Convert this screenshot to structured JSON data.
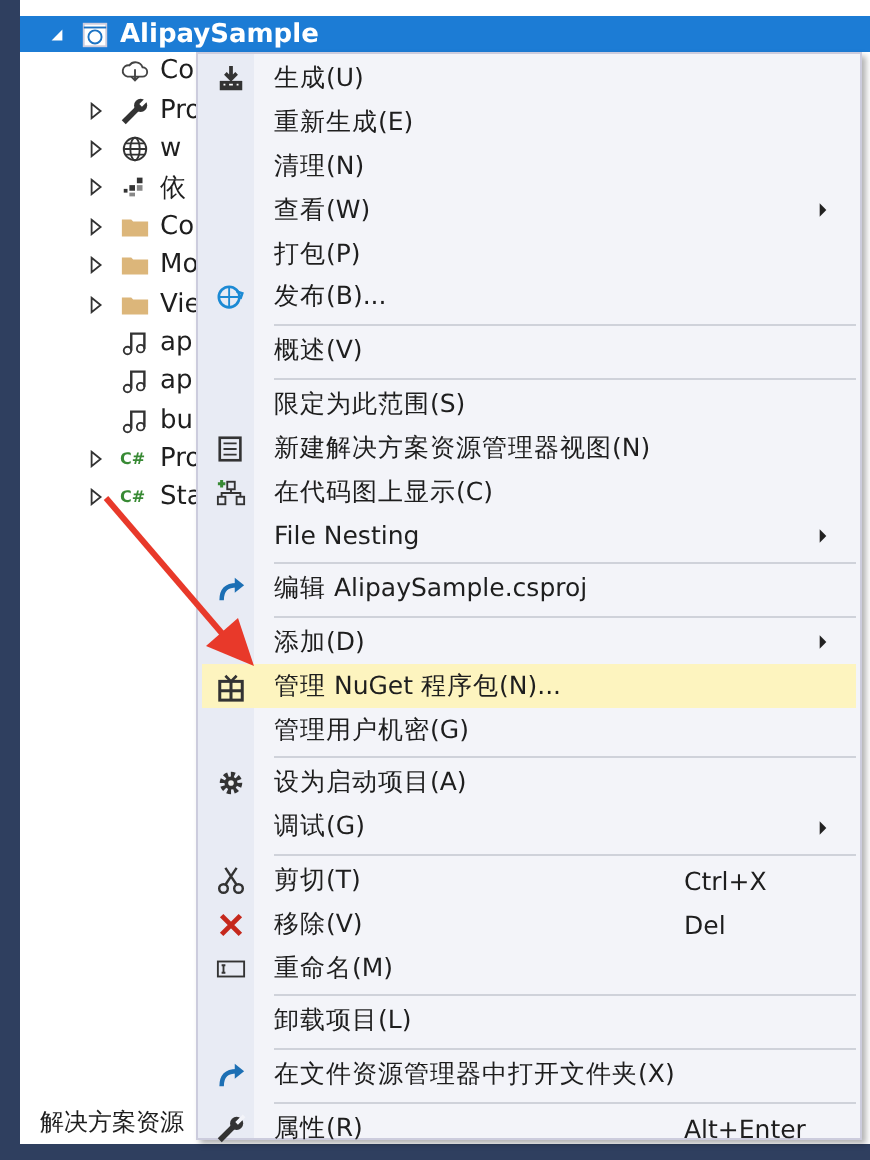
{
  "tree": {
    "root": {
      "label": "AlipaySample",
      "selected": true,
      "expanded": true
    },
    "items": [
      {
        "label": "Co"
      },
      {
        "label": "Pro",
        "expanded": false
      },
      {
        "label": "w",
        "expanded": false
      },
      {
        "label": "依",
        "expanded": false
      },
      {
        "label": "Co",
        "expanded": false
      },
      {
        "label": "Mo",
        "expanded": false
      },
      {
        "label": "Vie",
        "expanded": false
      },
      {
        "label": "ap"
      },
      {
        "label": "ap"
      },
      {
        "label": "bu"
      },
      {
        "label": "Pro",
        "expanded": false,
        "badge": "C#"
      },
      {
        "label": "Sta",
        "expanded": false,
        "badge": "C#"
      }
    ]
  },
  "status_tab": "解决方案资源",
  "context_menu": [
    {
      "kind": "item",
      "label": "生成(U)",
      "submenu": false,
      "selected": false
    },
    {
      "kind": "item",
      "label": "重新生成(E)",
      "submenu": false,
      "selected": false
    },
    {
      "kind": "item",
      "label": "清理(N)",
      "submenu": false,
      "selected": false
    },
    {
      "kind": "item",
      "label": "查看(W)",
      "submenu": true,
      "selected": false
    },
    {
      "kind": "item",
      "label": "打包(P)",
      "submenu": false,
      "selected": false
    },
    {
      "kind": "item",
      "label": "发布(B)...",
      "submenu": false,
      "selected": false
    },
    {
      "kind": "separator"
    },
    {
      "kind": "item",
      "label": "概述(V)",
      "submenu": false,
      "selected": false
    },
    {
      "kind": "separator"
    },
    {
      "kind": "item",
      "label": "限定为此范围(S)",
      "submenu": false,
      "selected": false
    },
    {
      "kind": "item",
      "label": "新建解决方案资源管理器视图(N)",
      "submenu": false,
      "selected": false
    },
    {
      "kind": "item",
      "label": "在代码图上显示(C)",
      "submenu": false,
      "selected": false
    },
    {
      "kind": "item",
      "label": "File Nesting",
      "submenu": true,
      "selected": false
    },
    {
      "kind": "separator"
    },
    {
      "kind": "item",
      "label": "编辑 AlipaySample.csproj",
      "submenu": false,
      "selected": false
    },
    {
      "kind": "separator"
    },
    {
      "kind": "item",
      "label": "添加(D)",
      "submenu": true,
      "selected": false
    },
    {
      "kind": "item",
      "label": "管理 NuGet 程序包(N)...",
      "submenu": false,
      "selected": true
    },
    {
      "kind": "item",
      "label": "管理用户机密(G)",
      "submenu": false,
      "selected": false
    },
    {
      "kind": "separator"
    },
    {
      "kind": "item",
      "label": "设为启动项目(A)",
      "submenu": false,
      "selected": false
    },
    {
      "kind": "item",
      "label": "调试(G)",
      "submenu": true,
      "selected": false
    },
    {
      "kind": "separator"
    },
    {
      "kind": "item",
      "label": "剪切(T)",
      "shortcut": "Ctrl+X",
      "submenu": false,
      "selected": false
    },
    {
      "kind": "item",
      "label": "移除(V)",
      "shortcut": "Del",
      "submenu": false,
      "selected": false
    },
    {
      "kind": "item",
      "label": "重命名(M)",
      "submenu": false,
      "selected": false
    },
    {
      "kind": "separator"
    },
    {
      "kind": "item",
      "label": "卸载项目(L)",
      "submenu": false,
      "selected": false
    },
    {
      "kind": "separator"
    },
    {
      "kind": "item",
      "label": "在文件资源管理器中打开文件夹(X)",
      "submenu": false,
      "selected": false
    },
    {
      "kind": "separator"
    },
    {
      "kind": "item",
      "label": "属性(R)",
      "shortcut": "Alt+Enter",
      "submenu": false,
      "selected": false
    }
  ]
}
